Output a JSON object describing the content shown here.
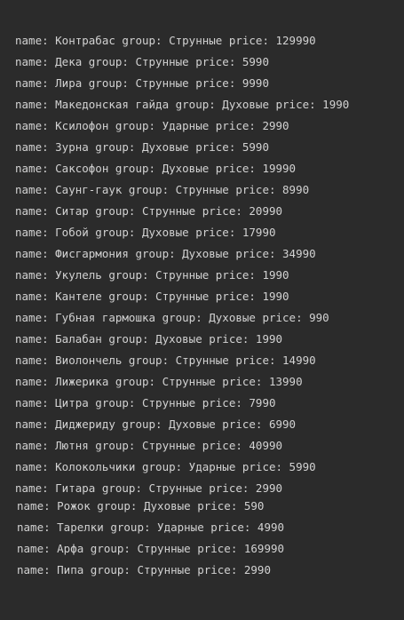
{
  "console": {
    "lines": [
      "name: Контрабас group: Струнные price: 129990",
      "name: Дека group: Струнные price: 5990",
      "name: Лира group: Струнные price: 9990",
      "name: Македонская гайда group: Духовые price: 1990",
      "name: Ксилофон group: Ударные price: 2990",
      "name: Зурна group: Духовые price: 5990",
      "name: Саксофон group: Духовые price: 19990",
      "name: Саунг-гаук group: Струнные price: 8990",
      "name: Ситар group: Струнные price: 20990",
      "name: Гобой group: Духовые price: 17990",
      "name: Фисгармония group: Духовые price: 34990",
      "name: Укулель group: Струнные price: 1990",
      "name: Кантеле group: Струнные price: 1990",
      "name: Губная гармошка group: Духовые price: 990",
      "name: Балабан group: Духовые price: 1990",
      "name: Виолончель group: Струнные price: 14990",
      "name: Лижерика group: Струнные price: 13990",
      "name: Цитра group: Струнные price: 7990",
      "name: Диджериду group: Духовые price: 6990",
      "name: Лютня group: Струнные price: 40990",
      "name: Колокольчики group: Ударные price: 5990",
      "name: Гитара group: Струнные price: 2990",
      "name: Рожок group: Духовые price: 590",
      "name: Тарелки group: Ударные price: 4990",
      "name: Арфа group: Струнные price: 169990",
      "name: Пипа group: Струнные price: 2990"
    ]
  }
}
